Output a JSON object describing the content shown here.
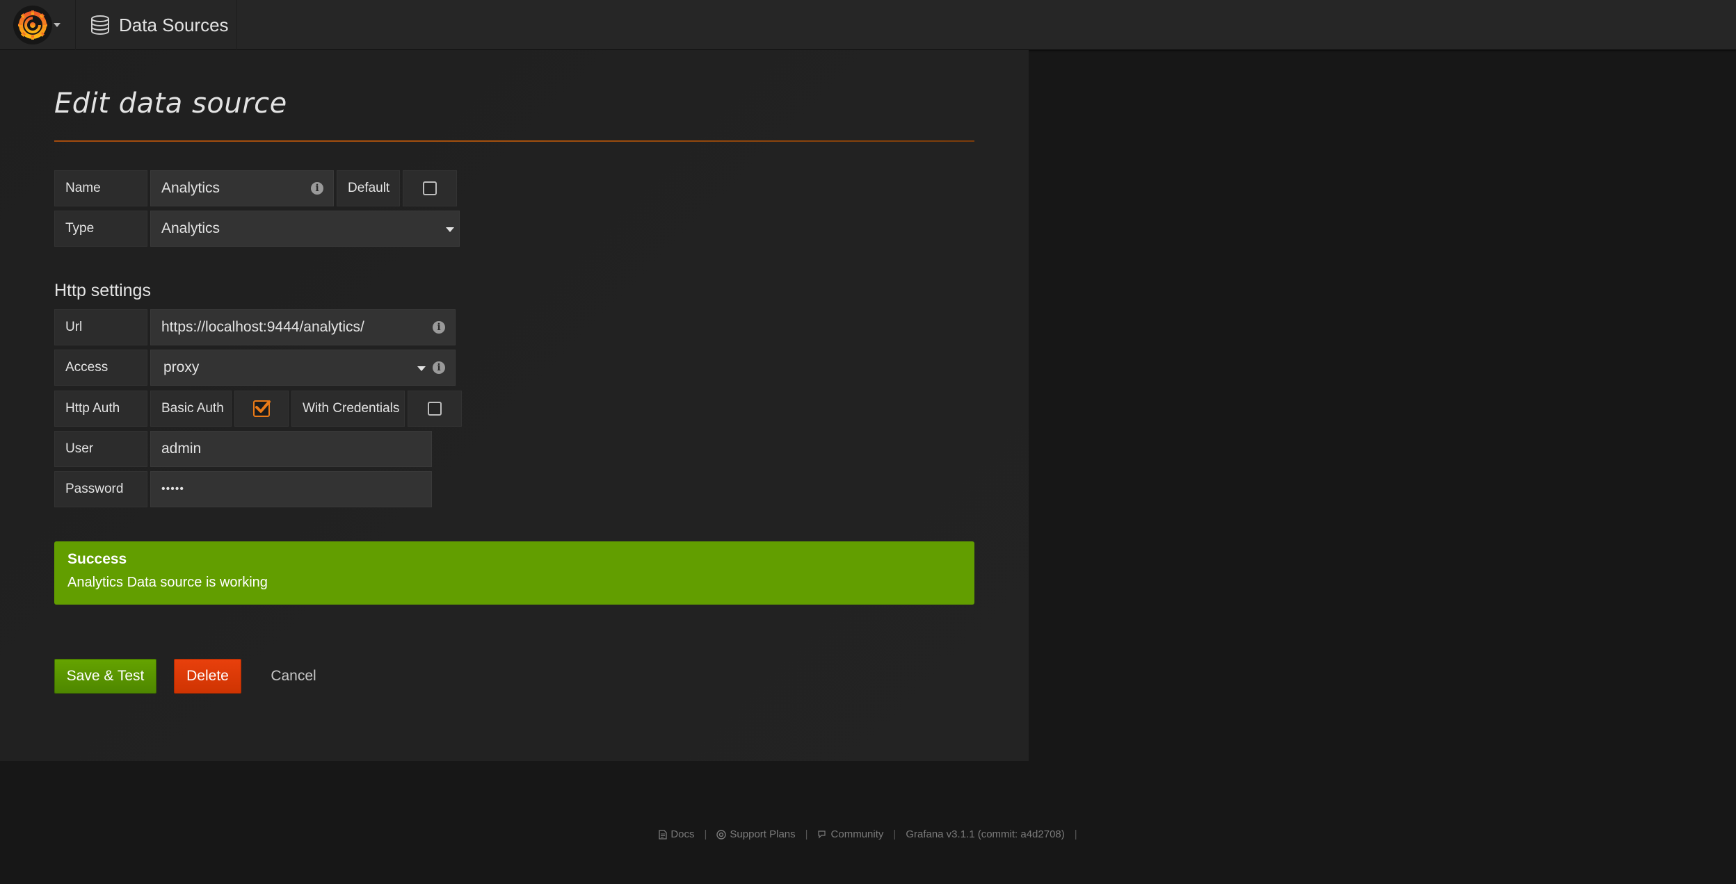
{
  "navbar": {
    "title": "Data Sources"
  },
  "page": {
    "title": "Edit data source"
  },
  "form": {
    "name_label": "Name",
    "name_value": "Analytics",
    "default_label": "Default",
    "default_checked": false,
    "type_label": "Type",
    "type_value": "Analytics"
  },
  "http": {
    "section_title": "Http settings",
    "url_label": "Url",
    "url_value": "https://localhost:9444/analytics/",
    "access_label": "Access",
    "access_value": "proxy",
    "auth_label": "Http Auth",
    "basic_auth_label": "Basic Auth",
    "basic_auth_checked": true,
    "with_credentials_label": "With Credentials",
    "with_credentials_checked": false,
    "user_label": "User",
    "user_value": "admin",
    "password_label": "Password",
    "password_value": "•••••"
  },
  "alert": {
    "title": "Success",
    "message": "Analytics Data source is working",
    "color": "#629e00"
  },
  "actions": {
    "save_label": "Save & Test",
    "delete_label": "Delete",
    "cancel_label": "Cancel"
  },
  "footer": {
    "docs": "Docs",
    "support": "Support Plans",
    "community": "Community",
    "version": "Grafana v3.1.1 (commit: a4d2708)"
  },
  "colors": {
    "accent": "#eb7b18",
    "success": "#629e00",
    "danger": "#e3400c"
  }
}
